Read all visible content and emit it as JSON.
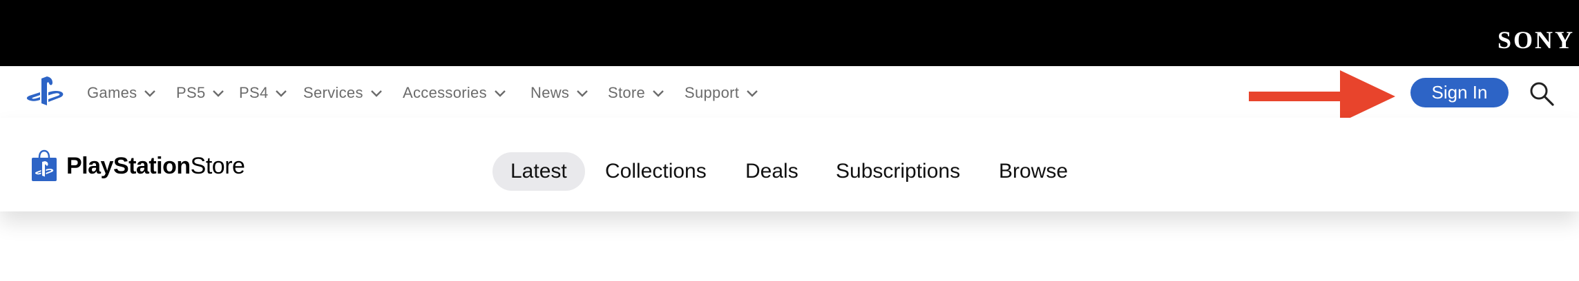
{
  "sony_bar": {
    "logo_text": "SONY"
  },
  "site_nav": {
    "items": [
      {
        "label": "Games"
      },
      {
        "label": "PS5"
      },
      {
        "label": "PS4"
      },
      {
        "label": "Services"
      },
      {
        "label": "Accessories"
      },
      {
        "label": "News"
      },
      {
        "label": "Store"
      },
      {
        "label": "Support"
      }
    ],
    "sign_in_label": "Sign In",
    "accent_color": "#2d64c6",
    "annotation_arrow_color": "#e8442c"
  },
  "store_nav": {
    "brand_playstation": "PlayStation",
    "brand_store": "Store",
    "tabs": [
      {
        "label": "Latest",
        "active": true
      },
      {
        "label": "Collections",
        "active": false
      },
      {
        "label": "Deals",
        "active": false
      },
      {
        "label": "Subscriptions",
        "active": false
      },
      {
        "label": "Browse",
        "active": false
      }
    ]
  }
}
